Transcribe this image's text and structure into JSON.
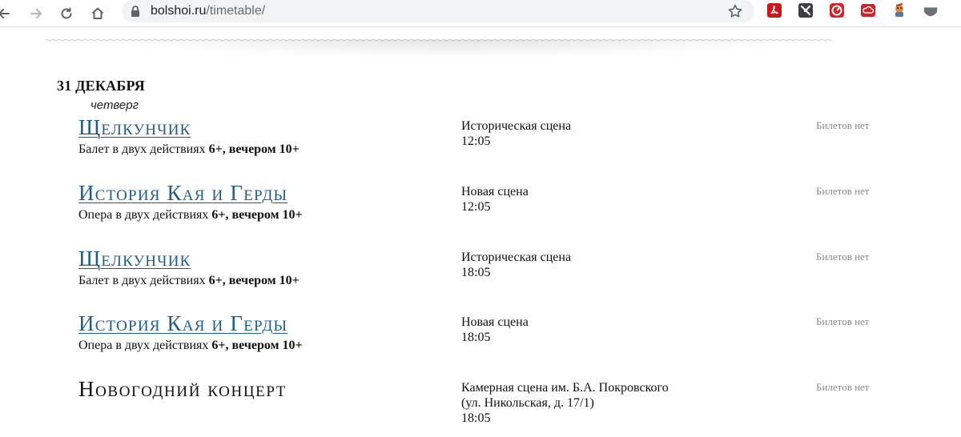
{
  "browser": {
    "url_host": "bolshoi.ru",
    "url_path": "/timetable/"
  },
  "schedule": {
    "date": "31 ДЕКАБРЯ",
    "weekday": "четверг",
    "events": [
      {
        "title": "Щелкунчик",
        "linked": true,
        "desc_prefix": "Балет в двух действиях ",
        "desc_bold": "6+, вечером 10+",
        "venue_lines": [
          "Историческая сцена",
          "12:05"
        ],
        "tickets": "Билетов нет"
      },
      {
        "title": "История Кая и Герды",
        "linked": true,
        "desc_prefix": "Опера в двух действиях ",
        "desc_bold": "6+, вечером 10+",
        "venue_lines": [
          "Новая сцена",
          "12:05"
        ],
        "tickets": "Билетов нет"
      },
      {
        "title": "Щелкунчик",
        "linked": true,
        "desc_prefix": "Балет в двух действиях ",
        "desc_bold": "6+, вечером 10+",
        "venue_lines": [
          "Историческая сцена",
          "18:05"
        ],
        "tickets": "Билетов нет"
      },
      {
        "title": "История Кая и Герды",
        "linked": true,
        "desc_prefix": "Опера в двух действиях ",
        "desc_bold": "6+, вечером 10+",
        "venue_lines": [
          "Новая сцена",
          "18:05"
        ],
        "tickets": "Билетов нет"
      },
      {
        "title": "Новогодний концерт",
        "linked": false,
        "desc_prefix": "",
        "desc_bold": "",
        "venue_lines": [
          "Камерная сцена им. Б.А. Покровского",
          "(ул. Никольская, д. 17/1)",
          "18:05"
        ],
        "tickets": "Билетов нет"
      }
    ]
  },
  "colors": {
    "link": "#1f5d8f",
    "muted": "#8a8a8a"
  },
  "icons": {
    "back": "arrow-left-icon",
    "forward": "arrow-right-icon",
    "reload": "reload-icon",
    "home": "home-icon",
    "lock": "lock-icon",
    "bookmark": "star-icon",
    "extensions": [
      "pdf-extension-icon",
      "x-extension-icon",
      "red-circle-extension-icon",
      "cloud-extension-icon",
      "character-extension-icon",
      "shield-extension-icon"
    ]
  }
}
